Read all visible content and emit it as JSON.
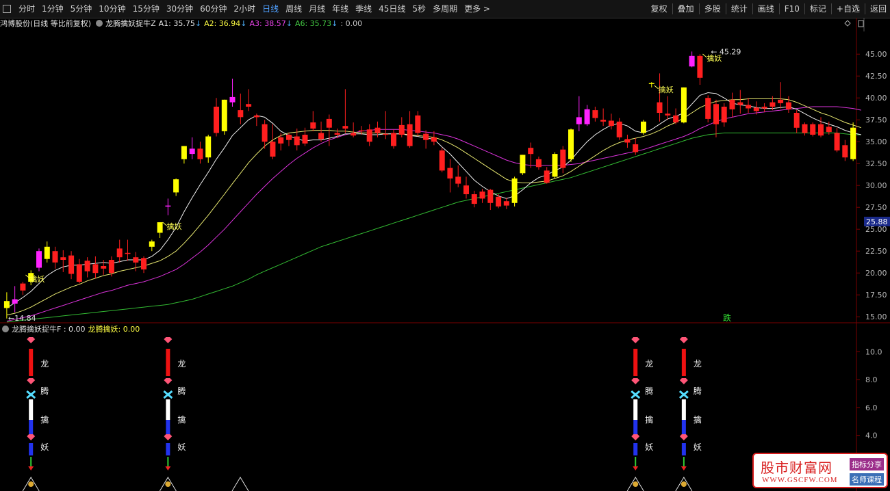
{
  "toolbar": {
    "periods": [
      "分时",
      "1分钟",
      "5分钟",
      "10分钟",
      "15分钟",
      "30分钟",
      "60分钟",
      "2小时",
      "日线",
      "周线",
      "月线",
      "年线",
      "季线",
      "45日线",
      "5秒",
      "多周期",
      "更多 >"
    ],
    "active_period": "日线",
    "right": [
      "复权",
      "叠加",
      "多股",
      "统计",
      "画线",
      "F10",
      "标记",
      "+自选",
      "返回"
    ]
  },
  "main_legend": {
    "stock": "鸿博股份(日线 等比前复权)",
    "indicator": "龙腾擒妖捉牛Z",
    "a1": "A1: 35.75",
    "a2": "A2: 36.94",
    "a3": "A3: 38.57",
    "a6": "A6: 35.73",
    "tail": ": 0.00",
    "down_arrow": "↓"
  },
  "sub_legend": {
    "indicator": "龙腾擒妖捉牛F : 0.00",
    "value": "龙腾擒妖: 0.00"
  },
  "annotations": {
    "high": "45.29",
    "low": "14.84",
    "qinyao": "擒妖",
    "die": "跌",
    "price_tag": "25.88"
  },
  "sub_labels": [
    "龙",
    "腾",
    "擒",
    "妖"
  ],
  "watermark": {
    "title": "股市财富网",
    "url": "WWW.GSCFW.COM",
    "tag1": "指标分享",
    "tag2": "名师课程"
  },
  "colors": {
    "up": "#ff1f1f",
    "down": "#ff1f1f",
    "yellow": "#ffff00",
    "magenta": "#ff22ff",
    "ma_white": "#f0f0f0",
    "ma_yellow": "#e8e870",
    "ma_magenta": "#dd33dd",
    "ma_green": "#33bb33",
    "grid": "#7a0000"
  },
  "chart_data": {
    "type": "candlestick",
    "ylim": [
      14.0,
      46.5
    ],
    "y_ticks": [
      15.0,
      17.5,
      20.0,
      22.5,
      25.0,
      27.5,
      30.0,
      32.5,
      35.0,
      37.5,
      40.0,
      42.5,
      45.0
    ],
    "sub_ticks": [
      4.0,
      6.0,
      8.0,
      10.0
    ],
    "candles": [
      {
        "o": 16.0,
        "h": 17.8,
        "l": 14.8,
        "c": 16.8,
        "k": "y"
      },
      {
        "o": 16.5,
        "h": 18.5,
        "l": 15.5,
        "c": 17.0,
        "k": "m"
      },
      {
        "o": 18.0,
        "h": 19.0,
        "l": 17.5,
        "c": 18.8,
        "k": "r"
      },
      {
        "o": 19.0,
        "h": 20.3,
        "l": 18.6,
        "c": 20.0,
        "k": "y"
      },
      {
        "o": 20.6,
        "h": 22.8,
        "l": 20.2,
        "c": 22.5,
        "k": "m"
      },
      {
        "o": 21.6,
        "h": 23.6,
        "l": 21.2,
        "c": 23.0,
        "k": "y"
      },
      {
        "o": 22.5,
        "h": 23.0,
        "l": 20.5,
        "c": 21.2,
        "k": "r"
      },
      {
        "o": 21.8,
        "h": 22.6,
        "l": 20.1,
        "c": 21.5,
        "k": "r"
      },
      {
        "o": 22.0,
        "h": 22.5,
        "l": 19.3,
        "c": 19.9,
        "k": "r"
      },
      {
        "o": 21.0,
        "h": 21.6,
        "l": 18.8,
        "c": 19.0,
        "k": "r"
      },
      {
        "o": 20.2,
        "h": 21.8,
        "l": 19.5,
        "c": 21.4,
        "k": "r"
      },
      {
        "o": 20.0,
        "h": 21.9,
        "l": 19.4,
        "c": 21.0,
        "k": "r"
      },
      {
        "o": 20.5,
        "h": 21.5,
        "l": 19.8,
        "c": 20.8,
        "k": "r"
      },
      {
        "o": 21.5,
        "h": 21.9,
        "l": 19.6,
        "c": 20.0,
        "k": "r"
      },
      {
        "o": 21.8,
        "h": 23.8,
        "l": 21.2,
        "c": 22.8,
        "k": "r"
      },
      {
        "o": 22.3,
        "h": 23.8,
        "l": 21.4,
        "c": 22.3,
        "k": "r"
      },
      {
        "o": 21.2,
        "h": 22.4,
        "l": 20.2,
        "c": 21.8,
        "k": "r"
      },
      {
        "o": 20.4,
        "h": 21.9,
        "l": 20.0,
        "c": 21.7,
        "k": "r"
      },
      {
        "o": 23.0,
        "h": 23.8,
        "l": 22.5,
        "c": 23.6,
        "k": "y"
      },
      {
        "o": 24.6,
        "h": 25.8,
        "l": 24.0,
        "c": 25.8,
        "k": "y"
      },
      {
        "o": 27.7,
        "h": 28.5,
        "l": 26.6,
        "c": 27.7,
        "k": "m"
      },
      {
        "o": 29.2,
        "h": 30.8,
        "l": 28.8,
        "c": 30.7,
        "k": "y"
      },
      {
        "o": 33.0,
        "h": 34.5,
        "l": 32.5,
        "c": 34.5,
        "k": "y"
      },
      {
        "o": 33.6,
        "h": 35.5,
        "l": 33.0,
        "c": 34.2,
        "k": "m"
      },
      {
        "o": 34.2,
        "h": 35.0,
        "l": 32.5,
        "c": 33.0,
        "k": "r"
      },
      {
        "o": 33.2,
        "h": 35.8,
        "l": 32.6,
        "c": 35.6,
        "k": "y"
      },
      {
        "o": 36.0,
        "h": 40.0,
        "l": 35.6,
        "c": 39.0,
        "k": "r"
      },
      {
        "o": 36.2,
        "h": 39.8,
        "l": 35.8,
        "c": 39.8,
        "k": "y"
      },
      {
        "o": 39.5,
        "h": 42.2,
        "l": 39.0,
        "c": 40.1,
        "k": "m"
      },
      {
        "o": 38.6,
        "h": 40.5,
        "l": 37.0,
        "c": 37.8,
        "k": "r"
      },
      {
        "o": 39.0,
        "h": 41.0,
        "l": 38.5,
        "c": 39.3,
        "k": "r"
      },
      {
        "o": 38.0,
        "h": 38.2,
        "l": 36.8,
        "c": 37.8,
        "k": "r"
      },
      {
        "o": 37.0,
        "h": 37.5,
        "l": 34.2,
        "c": 35.0,
        "k": "r"
      },
      {
        "o": 35.0,
        "h": 37.0,
        "l": 33.0,
        "c": 33.3,
        "k": "r"
      },
      {
        "o": 35.5,
        "h": 36.0,
        "l": 34.0,
        "c": 34.8,
        "k": "r"
      },
      {
        "o": 35.8,
        "h": 36.0,
        "l": 34.5,
        "c": 35.2,
        "k": "r"
      },
      {
        "o": 35.6,
        "h": 36.5,
        "l": 34.0,
        "c": 34.6,
        "k": "r"
      },
      {
        "o": 35.8,
        "h": 36.6,
        "l": 34.5,
        "c": 34.8,
        "k": "r"
      },
      {
        "o": 37.2,
        "h": 38.5,
        "l": 36.2,
        "c": 36.5,
        "k": "r"
      },
      {
        "o": 36.0,
        "h": 37.3,
        "l": 35.0,
        "c": 35.3,
        "k": "r"
      },
      {
        "o": 36.6,
        "h": 38.1,
        "l": 34.5,
        "c": 37.6,
        "k": "r"
      },
      {
        "o": 36.0,
        "h": 36.5,
        "l": 35.4,
        "c": 35.8,
        "k": "r"
      },
      {
        "o": 36.5,
        "h": 41.0,
        "l": 36.0,
        "c": 36.8,
        "k": "r"
      },
      {
        "o": 36.0,
        "h": 37.2,
        "l": 35.5,
        "c": 35.7,
        "k": "r"
      },
      {
        "o": 36.3,
        "h": 36.8,
        "l": 35.8,
        "c": 36.3,
        "k": "r"
      },
      {
        "o": 36.4,
        "h": 37.0,
        "l": 34.5,
        "c": 35.0,
        "k": "r"
      },
      {
        "o": 36.0,
        "h": 37.3,
        "l": 35.5,
        "c": 36.6,
        "k": "r"
      },
      {
        "o": 35.8,
        "h": 38.5,
        "l": 35.3,
        "c": 35.9,
        "k": "r"
      },
      {
        "o": 34.5,
        "h": 36.4,
        "l": 34.2,
        "c": 36.0,
        "k": "r"
      },
      {
        "o": 36.9,
        "h": 37.8,
        "l": 35.5,
        "c": 35.8,
        "k": "r"
      },
      {
        "o": 37.0,
        "h": 38.5,
        "l": 34.3,
        "c": 34.5,
        "k": "r"
      },
      {
        "o": 38.0,
        "h": 38.5,
        "l": 35.6,
        "c": 36.0,
        "k": "r"
      },
      {
        "o": 35.9,
        "h": 36.3,
        "l": 34.2,
        "c": 35.2,
        "k": "r"
      },
      {
        "o": 35.5,
        "h": 36.2,
        "l": 34.6,
        "c": 35.0,
        "k": "r"
      },
      {
        "o": 34.0,
        "h": 34.3,
        "l": 31.5,
        "c": 31.7,
        "k": "r"
      },
      {
        "o": 32.0,
        "h": 33.0,
        "l": 29.2,
        "c": 30.8,
        "k": "r"
      },
      {
        "o": 31.0,
        "h": 32.3,
        "l": 29.8,
        "c": 30.2,
        "k": "r"
      },
      {
        "o": 30.0,
        "h": 31.0,
        "l": 28.5,
        "c": 29.0,
        "k": "r"
      },
      {
        "o": 29.0,
        "h": 29.4,
        "l": 27.5,
        "c": 27.9,
        "k": "r"
      },
      {
        "o": 28.5,
        "h": 29.6,
        "l": 28.0,
        "c": 29.3,
        "k": "r"
      },
      {
        "o": 29.5,
        "h": 29.6,
        "l": 27.2,
        "c": 28.0,
        "k": "r"
      },
      {
        "o": 28.7,
        "h": 29.0,
        "l": 27.4,
        "c": 27.6,
        "k": "r"
      },
      {
        "o": 27.7,
        "h": 28.6,
        "l": 27.3,
        "c": 28.2,
        "k": "r"
      },
      {
        "o": 28.0,
        "h": 31.0,
        "l": 27.6,
        "c": 30.8,
        "k": "y"
      },
      {
        "o": 31.4,
        "h": 33.5,
        "l": 31.2,
        "c": 33.5,
        "k": "y"
      },
      {
        "o": 33.6,
        "h": 34.9,
        "l": 32.0,
        "c": 34.3,
        "k": "r"
      },
      {
        "o": 33.0,
        "h": 33.3,
        "l": 31.8,
        "c": 32.1,
        "k": "r"
      },
      {
        "o": 31.7,
        "h": 32.1,
        "l": 30.2,
        "c": 30.3,
        "k": "r"
      },
      {
        "o": 31.0,
        "h": 33.8,
        "l": 30.8,
        "c": 33.6,
        "k": "y"
      },
      {
        "o": 32.0,
        "h": 34.5,
        "l": 31.4,
        "c": 34.1,
        "k": "r"
      },
      {
        "o": 33.0,
        "h": 36.5,
        "l": 32.7,
        "c": 36.4,
        "k": "y"
      },
      {
        "o": 37.0,
        "h": 40.2,
        "l": 36.2,
        "c": 37.8,
        "k": "m"
      },
      {
        "o": 37.0,
        "h": 39.2,
        "l": 36.8,
        "c": 38.7,
        "k": "m"
      },
      {
        "o": 38.6,
        "h": 39.0,
        "l": 37.3,
        "c": 37.7,
        "k": "r"
      },
      {
        "o": 37.5,
        "h": 38.8,
        "l": 36.8,
        "c": 37.3,
        "k": "r"
      },
      {
        "o": 36.8,
        "h": 38.2,
        "l": 36.4,
        "c": 37.4,
        "k": "r"
      },
      {
        "o": 37.3,
        "h": 37.7,
        "l": 35.2,
        "c": 35.5,
        "k": "r"
      },
      {
        "o": 35.3,
        "h": 35.8,
        "l": 34.3,
        "c": 34.9,
        "k": "r"
      },
      {
        "o": 34.7,
        "h": 35.4,
        "l": 33.5,
        "c": 33.8,
        "k": "r"
      },
      {
        "o": 36.0,
        "h": 37.5,
        "l": 35.8,
        "c": 37.3,
        "k": "y"
      },
      {
        "o": 41.7,
        "h": 41.8,
        "l": 41.2,
        "c": 41.7,
        "k": "y"
      },
      {
        "o": 39.5,
        "h": 42.8,
        "l": 37.3,
        "c": 38.3,
        "k": "r"
      },
      {
        "o": 38.2,
        "h": 40.2,
        "l": 37.5,
        "c": 38.0,
        "k": "r"
      },
      {
        "o": 38.0,
        "h": 38.8,
        "l": 37.0,
        "c": 37.2,
        "k": "r"
      },
      {
        "o": 37.2,
        "h": 41.2,
        "l": 37.1,
        "c": 41.2,
        "k": "y"
      },
      {
        "o": 43.6,
        "h": 45.3,
        "l": 43.5,
        "c": 44.8,
        "k": "m"
      },
      {
        "o": 44.8,
        "h": 45.0,
        "l": 41.5,
        "c": 42.3,
        "k": "r"
      },
      {
        "o": 40.0,
        "h": 40.3,
        "l": 37.2,
        "c": 37.6,
        "k": "r"
      },
      {
        "o": 39.3,
        "h": 39.8,
        "l": 35.5,
        "c": 37.0,
        "k": "r"
      },
      {
        "o": 39.0,
        "h": 39.4,
        "l": 36.7,
        "c": 37.2,
        "k": "r"
      },
      {
        "o": 39.8,
        "h": 40.6,
        "l": 37.8,
        "c": 38.7,
        "k": "r"
      },
      {
        "o": 39.5,
        "h": 40.9,
        "l": 38.2,
        "c": 39.2,
        "k": "r"
      },
      {
        "o": 39.2,
        "h": 40.0,
        "l": 38.3,
        "c": 38.8,
        "k": "r"
      },
      {
        "o": 38.9,
        "h": 39.6,
        "l": 38.1,
        "c": 38.5,
        "k": "r"
      },
      {
        "o": 38.8,
        "h": 39.4,
        "l": 38.4,
        "c": 39.0,
        "k": "r"
      },
      {
        "o": 39.5,
        "h": 40.2,
        "l": 38.6,
        "c": 39.0,
        "k": "r"
      },
      {
        "o": 39.8,
        "h": 41.8,
        "l": 38.8,
        "c": 39.4,
        "k": "r"
      },
      {
        "o": 39.5,
        "h": 40.2,
        "l": 38.3,
        "c": 38.7,
        "k": "r"
      },
      {
        "o": 38.3,
        "h": 38.6,
        "l": 36.0,
        "c": 36.6,
        "k": "r"
      },
      {
        "o": 37.0,
        "h": 37.2,
        "l": 35.7,
        "c": 36.0,
        "k": "r"
      },
      {
        "o": 37.0,
        "h": 37.2,
        "l": 35.6,
        "c": 35.8,
        "k": "r"
      },
      {
        "o": 37.0,
        "h": 37.8,
        "l": 35.5,
        "c": 35.7,
        "k": "r"
      },
      {
        "o": 36.7,
        "h": 37.3,
        "l": 35.8,
        "c": 36.1,
        "k": "r"
      },
      {
        "o": 36.0,
        "h": 36.6,
        "l": 33.8,
        "c": 34.0,
        "k": "r"
      },
      {
        "o": 34.6,
        "h": 35.2,
        "l": 32.8,
        "c": 33.2,
        "k": "r"
      },
      {
        "o": 33.0,
        "h": 37.2,
        "l": 32.8,
        "c": 36.6,
        "k": "y"
      }
    ],
    "ma_white": [
      16.0,
      16.6,
      17.2,
      17.9,
      18.8,
      19.7,
      20.3,
      20.7,
      20.9,
      20.9,
      21.0,
      21.1,
      21.2,
      21.1,
      21.3,
      21.5,
      21.5,
      21.5,
      21.9,
      22.6,
      23.8,
      25.2,
      27.0,
      28.6,
      30.1,
      31.5,
      33.0,
      34.3,
      35.7,
      36.6,
      37.5,
      38.0,
      37.8,
      37.1,
      36.2,
      35.7,
      35.3,
      35.1,
      35.2,
      35.2,
      35.4,
      35.6,
      35.9,
      35.9,
      35.9,
      35.8,
      35.8,
      35.9,
      35.9,
      35.9,
      35.7,
      35.6,
      35.4,
      35.3,
      34.4,
      33.6,
      32.6,
      31.6,
      30.6,
      29.9,
      29.3,
      28.8,
      28.5,
      28.8,
      29.5,
      30.3,
      30.9,
      31.2,
      31.7,
      32.1,
      32.9,
      34.0,
      35.0,
      35.8,
      36.4,
      36.9,
      37.1,
      36.8,
      36.2,
      36.0,
      36.4,
      37.0,
      37.6,
      37.9,
      38.3,
      39.3,
      40.3,
      40.6,
      40.5,
      40.0,
      39.4,
      39.2,
      39.1,
      38.9,
      38.8,
      38.8,
      38.9,
      39.0,
      38.7,
      38.2,
      37.7,
      37.3,
      37.0,
      36.7,
      36.3,
      36.0,
      35.8
    ],
    "ma_yellow": [
      15.2,
      15.4,
      15.7,
      16.1,
      16.6,
      17.1,
      17.6,
      18.0,
      18.4,
      18.7,
      19.1,
      19.4,
      19.7,
      19.9,
      20.2,
      20.4,
      20.6,
      20.8,
      21.1,
      21.4,
      21.9,
      22.5,
      23.4,
      24.4,
      25.5,
      26.6,
      27.8,
      29.0,
      30.2,
      31.4,
      32.6,
      33.6,
      34.5,
      35.2,
      35.7,
      36.0,
      36.1,
      36.2,
      36.3,
      36.3,
      36.3,
      36.2,
      36.2,
      36.1,
      36.0,
      36.0,
      36.0,
      35.9,
      35.9,
      35.9,
      35.8,
      35.7,
      35.6,
      35.5,
      35.2,
      34.8,
      34.3,
      33.7,
      33.1,
      32.5,
      31.9,
      31.3,
      30.7,
      30.4,
      30.3,
      30.3,
      30.4,
      30.5,
      30.8,
      31.1,
      31.6,
      32.2,
      32.8,
      33.4,
      34.0,
      34.5,
      34.9,
      35.2,
      35.4,
      35.6,
      35.9,
      36.3,
      36.8,
      37.2,
      37.7,
      38.3,
      38.9,
      39.3,
      39.6,
      39.7,
      39.8,
      39.8,
      39.9,
      39.9,
      39.9,
      39.9,
      39.9,
      39.8,
      39.5,
      39.1,
      38.7,
      38.3,
      38.0,
      37.6,
      37.2,
      36.9,
      36.6
    ],
    "ma_magenta": [
      14.5,
      14.7,
      14.9,
      15.1,
      15.4,
      15.7,
      16.0,
      16.3,
      16.6,
      16.9,
      17.2,
      17.5,
      17.8,
      18.0,
      18.3,
      18.6,
      18.8,
      19.0,
      19.3,
      19.6,
      20.0,
      20.4,
      21.0,
      21.7,
      22.4,
      23.2,
      24.1,
      25.0,
      26.0,
      27.0,
      28.0,
      29.0,
      29.9,
      30.8,
      31.6,
      32.4,
      33.1,
      33.7,
      34.3,
      34.8,
      35.2,
      35.5,
      35.8,
      36.0,
      36.2,
      36.3,
      36.4,
      36.4,
      36.4,
      36.4,
      36.3,
      36.2,
      36.1,
      36.0,
      35.8,
      35.6,
      35.3,
      34.9,
      34.5,
      34.1,
      33.7,
      33.3,
      32.9,
      32.6,
      32.4,
      32.3,
      32.3,
      32.3,
      32.3,
      32.3,
      32.4,
      32.5,
      32.7,
      32.9,
      33.1,
      33.3,
      33.5,
      33.7,
      33.9,
      34.1,
      34.4,
      34.7,
      35.0,
      35.3,
      35.6,
      36.0,
      36.5,
      36.9,
      37.3,
      37.6,
      37.8,
      38.0,
      38.2,
      38.3,
      38.4,
      38.5,
      38.6,
      38.7,
      38.8,
      38.9,
      39.0,
      39.0,
      39.0,
      39.0,
      38.9,
      38.8,
      38.6
    ],
    "ma_green": [
      14.4,
      14.5,
      14.6,
      14.7,
      14.8,
      14.9,
      15.0,
      15.1,
      15.2,
      15.3,
      15.4,
      15.5,
      15.6,
      15.7,
      15.8,
      15.9,
      16.0,
      16.1,
      16.2,
      16.3,
      16.4,
      16.6,
      16.8,
      17.0,
      17.3,
      17.6,
      17.9,
      18.2,
      18.5,
      18.9,
      19.3,
      19.8,
      20.2,
      20.6,
      21.0,
      21.4,
      21.8,
      22.2,
      22.6,
      23.0,
      23.3,
      23.6,
      23.9,
      24.2,
      24.5,
      24.8,
      25.1,
      25.4,
      25.7,
      26.0,
      26.3,
      26.6,
      26.9,
      27.2,
      27.5,
      27.8,
      28.1,
      28.3,
      28.5,
      28.7,
      28.9,
      29.1,
      29.3,
      29.5,
      29.7,
      29.9,
      30.1,
      30.3,
      30.5,
      30.7,
      30.9,
      31.2,
      31.5,
      31.8,
      32.1,
      32.4,
      32.7,
      33.0,
      33.3,
      33.6,
      33.9,
      34.2,
      34.5,
      34.8,
      35.1,
      35.4,
      35.6,
      35.8,
      35.9,
      36.0,
      36.0,
      36.0,
      36.0,
      36.0,
      36.0,
      36.0,
      36.0,
      36.0,
      36.0,
      36.0,
      36.0,
      36.0,
      36.0,
      36.0,
      35.9,
      35.8,
      35.8
    ]
  }
}
